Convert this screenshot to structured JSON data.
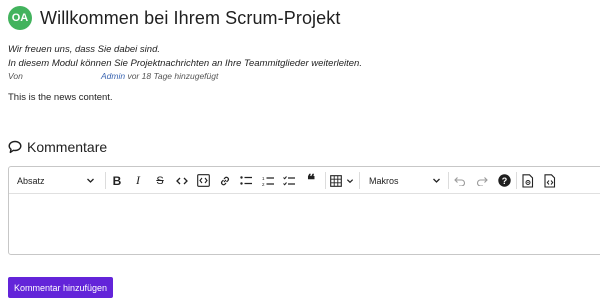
{
  "header": {
    "avatar_initials": "OA",
    "avatar_color": "#42b35d",
    "title": "Willkommen bei Ihrem Scrum-Projekt"
  },
  "summary": {
    "line1": "Wir freuen uns, dass Sie dabei sind.",
    "line2": "In diesem Modul können Sie Projektnachrichten an Ihre Teammitglieder weiterleiten."
  },
  "author": {
    "label": "Von",
    "name": "Admin",
    "time": " vor 18 Tage hinzugefügt"
  },
  "content": "This is the news content.",
  "comments": {
    "icon": "speech-bubble-icon",
    "heading": "Kommentare"
  },
  "toolbar": {
    "paragraph_select": "Absatz",
    "macros_select": "Makros",
    "icons": [
      "bold-icon",
      "italic-icon",
      "strikethrough-icon",
      "inline-code-icon",
      "code-block-icon",
      "link-icon",
      "bulleted-list-icon",
      "numbered-list-icon",
      "todo-list-icon",
      "blockquote-icon",
      "table-icon",
      "undo-icon",
      "redo-icon",
      "help-icon",
      "preview-icon",
      "source-icon"
    ]
  },
  "add_button": {
    "label": "Kommentar hinzufügen",
    "color": "#6324d9"
  }
}
